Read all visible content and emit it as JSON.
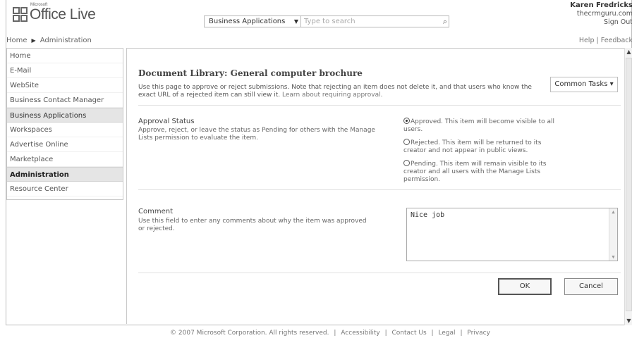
{
  "header": {
    "logo_small": "Microsoft",
    "logo_main": "Office Live",
    "breadcrumb": [
      "Home",
      "Administration"
    ],
    "search_category": "Business Applications",
    "search_placeholder": "Type to search",
    "user_name": "Karen Fredricks",
    "user_site": "thecrmguru.com",
    "sign_out": "Sign Out",
    "help": "Help",
    "feedback": "Feedback"
  },
  "sidebar": {
    "items": [
      {
        "label": "Home"
      },
      {
        "label": "E-Mail"
      },
      {
        "label": "WebSite"
      },
      {
        "label": "Business Contact Manager"
      },
      {
        "label": "Business Applications"
      },
      {
        "label": "Workspaces"
      },
      {
        "label": "Advertise Online"
      },
      {
        "label": "Marketplace"
      },
      {
        "label": "Administration"
      },
      {
        "label": "Resource Center"
      }
    ]
  },
  "main": {
    "title": "Document Library: General computer brochure",
    "description": "Use this page to approve or reject submissions. Note that rejecting an item does not delete it, and that users who know the exact URL of a rejected item can still view it.",
    "learn_more": "Learn about requiring approval.",
    "common_tasks": "Common Tasks ▾",
    "approval": {
      "label": "Approval Status",
      "desc": "Approve, reject, or leave the status as Pending for others with the Manage Lists permission to evaluate the item.",
      "options": [
        {
          "text": "Approved. This item will become visible to all users.",
          "checked": true
        },
        {
          "text": "Rejected. This item will be returned to its creator and not appear in public views.",
          "checked": false
        },
        {
          "text": "Pending. This item will remain visible to its creator and all users with the Manage Lists permission.",
          "checked": false
        }
      ]
    },
    "comment": {
      "label": "Comment",
      "desc": "Use this field to enter any comments about why the item was approved or rejected.",
      "value": "Nice job"
    },
    "ok_label": "OK",
    "cancel_label": "Cancel"
  },
  "footer": {
    "copyright": "© 2007 Microsoft Corporation. All rights reserved.",
    "links": [
      "Accessibility",
      "Contact Us",
      "Legal",
      "Privacy"
    ]
  }
}
